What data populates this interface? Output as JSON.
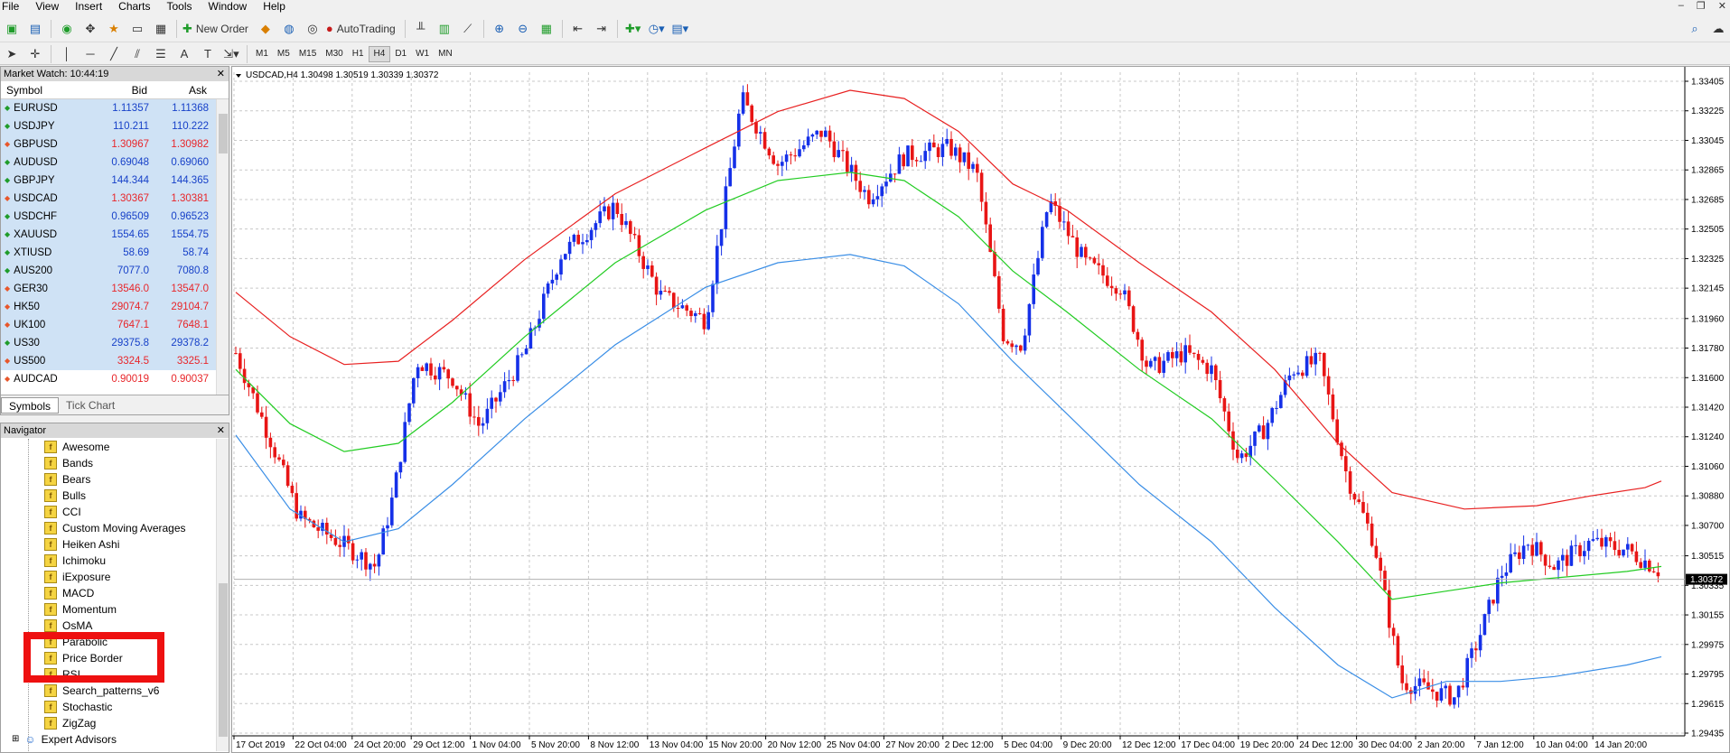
{
  "menu": [
    "File",
    "View",
    "Insert",
    "Charts",
    "Tools",
    "Window",
    "Help"
  ],
  "toolbar": {
    "new_order": "New Order",
    "autotrading": "AutoTrading",
    "timeframes": [
      "M1",
      "M5",
      "M15",
      "M30",
      "H1",
      "H4",
      "D1",
      "W1",
      "MN"
    ],
    "active_timeframe": "H4"
  },
  "market_watch": {
    "title": "Market Watch: 10:44:19",
    "col_symbol": "Symbol",
    "col_bid": "Bid",
    "col_ask": "Ask",
    "rows": [
      {
        "symbol": "EURUSD",
        "bid": "1.11357",
        "ask": "1.11368",
        "dir": "up"
      },
      {
        "symbol": "USDJPY",
        "bid": "110.211",
        "ask": "110.222",
        "dir": "up"
      },
      {
        "symbol": "GBPUSD",
        "bid": "1.30967",
        "ask": "1.30982",
        "dir": "down"
      },
      {
        "symbol": "AUDUSD",
        "bid": "0.69048",
        "ask": "0.69060",
        "dir": "up"
      },
      {
        "symbol": "GBPJPY",
        "bid": "144.344",
        "ask": "144.365",
        "dir": "up"
      },
      {
        "symbol": "USDCAD",
        "bid": "1.30367",
        "ask": "1.30381",
        "dir": "down"
      },
      {
        "symbol": "USDCHF",
        "bid": "0.96509",
        "ask": "0.96523",
        "dir": "up"
      },
      {
        "symbol": "XAUUSD",
        "bid": "1554.65",
        "ask": "1554.75",
        "dir": "up"
      },
      {
        "symbol": "XTIUSD",
        "bid": "58.69",
        "ask": "58.74",
        "dir": "up"
      },
      {
        "symbol": "AUS200",
        "bid": "7077.0",
        "ask": "7080.8",
        "dir": "up"
      },
      {
        "symbol": "GER30",
        "bid": "13546.0",
        "ask": "13547.0",
        "dir": "down"
      },
      {
        "symbol": "HK50",
        "bid": "29074.7",
        "ask": "29104.7",
        "dir": "down"
      },
      {
        "symbol": "UK100",
        "bid": "7647.1",
        "ask": "7648.1",
        "dir": "down"
      },
      {
        "symbol": "US30",
        "bid": "29375.8",
        "ask": "29378.2",
        "dir": "up"
      },
      {
        "symbol": "US500",
        "bid": "3324.5",
        "ask": "3325.1",
        "dir": "down"
      },
      {
        "symbol": "AUDCAD",
        "bid": "0.90019",
        "ask": "0.90037",
        "dir": "down"
      }
    ],
    "tabs": [
      "Symbols",
      "Tick Chart"
    ]
  },
  "navigator": {
    "title": "Navigator",
    "items": [
      "Awesome",
      "Bands",
      "Bears",
      "Bulls",
      "CCI",
      "Custom Moving Averages",
      "Heiken Ashi",
      "Ichimoku",
      "iExposure",
      "MACD",
      "Momentum",
      "OsMA",
      "Parabolic",
      "Price Border",
      "RSI",
      "Search_patterns_v6",
      "Stochastic",
      "ZigZag"
    ],
    "expert_advisors": "Expert Advisors"
  },
  "chart": {
    "header": "USDCAD,H4  1.30498 1.30519 1.30339 1.30372",
    "current_price": "1.30372",
    "price_labels": [
      "1.33405",
      "1.33225",
      "1.33045",
      "1.32865",
      "1.32685",
      "1.32505",
      "1.32325",
      "1.32145",
      "1.31960",
      "1.31780",
      "1.31600",
      "1.31420",
      "1.31240",
      "1.31060",
      "1.30880",
      "1.30700",
      "1.30515",
      "1.30335",
      "1.30155",
      "1.29975",
      "1.29795",
      "1.29615",
      "1.29435"
    ],
    "time_labels": [
      "17 Oct 2019",
      "22 Oct 04:00",
      "24 Oct 20:00",
      "29 Oct 12:00",
      "1 Nov 04:00",
      "5 Nov 20:00",
      "8 Nov 12:00",
      "13 Nov 04:00",
      "15 Nov 20:00",
      "20 Nov 12:00",
      "25 Nov 04:00",
      "27 Nov 20:00",
      "2 Dec 12:00",
      "5 Dec 04:00",
      "9 Dec 20:00",
      "12 Dec 12:00",
      "17 Dec 04:00",
      "19 Dec 20:00",
      "24 Dec 12:00",
      "30 Dec 04:00",
      "2 Jan 20:00",
      "7 Jan 12:00",
      "10 Jan 04:00",
      "14 Jan 20:00"
    ],
    "colors": {
      "bull": "#1530e8",
      "bear": "#e81515",
      "band_upper": "#e82020",
      "band_mid": "#22cc22",
      "band_lower": "#3a8ee6"
    }
  }
}
